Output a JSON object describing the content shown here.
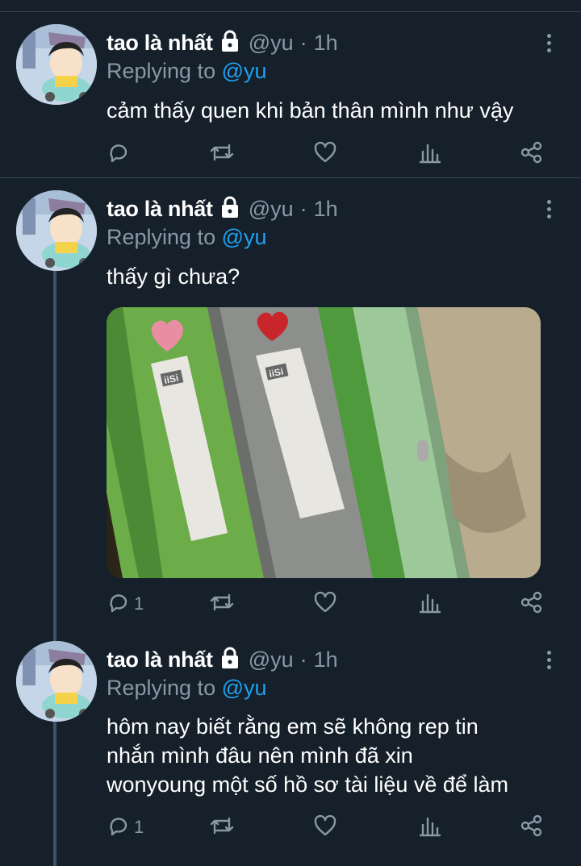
{
  "tweets": [
    {
      "display_name": "tao là nhất",
      "handle": "@yu",
      "separator": "·",
      "time": "1h",
      "replying_prefix": "Replying to",
      "replying_handle": "@yu",
      "text": "cảm thấy quen khi bản thân mình như vậy",
      "reply_count": "",
      "icons": [
        "reply-icon",
        "retweet-icon",
        "like-icon",
        "analytics-icon",
        "share-icon"
      ]
    },
    {
      "display_name": "tao là nhất",
      "handle": "@yu",
      "separator": "·",
      "time": "1h",
      "replying_prefix": "Replying to",
      "replying_handle": "@yu",
      "text": "thấy gì chưa?",
      "reply_count": "1",
      "media": {
        "description": "",
        "folder_label_1": "iiSi",
        "folder_label_2": "iiSi"
      }
    },
    {
      "display_name": "tao là nhất",
      "handle": "@yu",
      "separator": "·",
      "time": "1h",
      "replying_prefix": "Replying to",
      "replying_handle": "@yu",
      "text_lines": [
        "hôm nay biết rằng em sẽ không rep tin",
        "nhắn mình đâu nên mình đã xin",
        "wonyoung một số hồ sơ tài liệu về để làm"
      ],
      "reply_count": "1"
    }
  ],
  "colors": {
    "background": "#15202b",
    "secondary_text": "#8899a6",
    "link": "#1da1f2",
    "divider": "#38444d"
  }
}
